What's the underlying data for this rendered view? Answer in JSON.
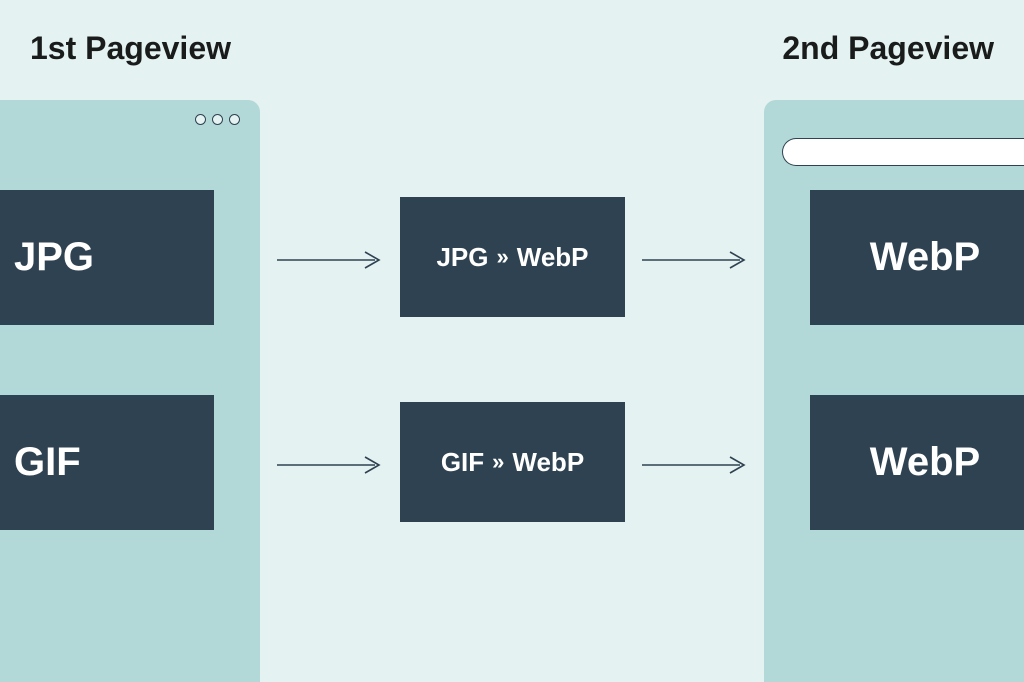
{
  "headings": {
    "first": "1st Pageview",
    "second": "2nd Pageview"
  },
  "rows": [
    {
      "source": "JPG",
      "convert_from": "JPG",
      "convert_to": "WebP",
      "result": "WebP"
    },
    {
      "source": "GIF",
      "convert_from": "GIF",
      "convert_to": "WebP",
      "result": "WebP"
    }
  ]
}
